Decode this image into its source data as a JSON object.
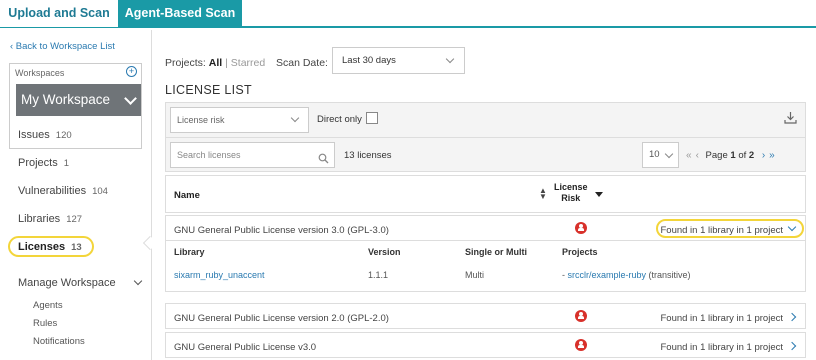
{
  "tabs": [
    "Upload and Scan",
    "Agent-Based Scan"
  ],
  "sidebar": {
    "back_link": "‹ Back to Workspace List",
    "workspaces_label": "Workspaces",
    "workspace_name": "My Workspace",
    "nav": [
      {
        "label": "Issues",
        "count": "120"
      },
      {
        "label": "Projects",
        "count": "1"
      },
      {
        "label": "Vulnerabilities",
        "count": "104"
      },
      {
        "label": "Libraries",
        "count": "127"
      },
      {
        "label": "Licenses",
        "count": "13"
      }
    ],
    "manage_label": "Manage Workspace",
    "manage_items": [
      "Agents",
      "Rules",
      "Notifications"
    ]
  },
  "filters": {
    "projects_label": "Projects:",
    "all": "All",
    "separator": "|",
    "starred": "Starred",
    "scan_date_label": "Scan Date:",
    "scan_date_value": "Last 30 days"
  },
  "title": "LICENSE LIST",
  "toolbar": {
    "risk_placeholder": "License risk",
    "direct_only": "Direct only",
    "search_placeholder": "Search licenses",
    "count": "13 licenses",
    "page_size": "10",
    "page_prefix": "Page",
    "page_current": "1",
    "page_of": "of",
    "page_total": "2"
  },
  "table": {
    "col_name": "Name",
    "col_risk": [
      "License",
      "Risk"
    ],
    "rows": [
      {
        "name": "GNU General Public License version 3.0 (GPL-3.0)",
        "found": "Found in 1 library in 1 project"
      },
      {
        "name": "GNU General Public License version 2.0 (GPL-2.0)",
        "found": "Found in 1 library in 1 project"
      },
      {
        "name": "GNU General Public License v3.0",
        "found": "Found in 1 library in 1 project"
      }
    ],
    "detail": {
      "headers": [
        "Library",
        "Version",
        "Single or Multi",
        "Projects"
      ],
      "library": "sixarm_ruby_unaccent",
      "version": "1.1.1",
      "single_multi": "Multi",
      "project_prefix": "- ",
      "project": "srcclr/example-ruby",
      "project_suffix": " (transitive)"
    }
  },
  "colors": {
    "accent": "#1a9aa6",
    "link": "#2a7ab0",
    "risk_high": "#d8312b",
    "highlight": "#f3d53a"
  }
}
